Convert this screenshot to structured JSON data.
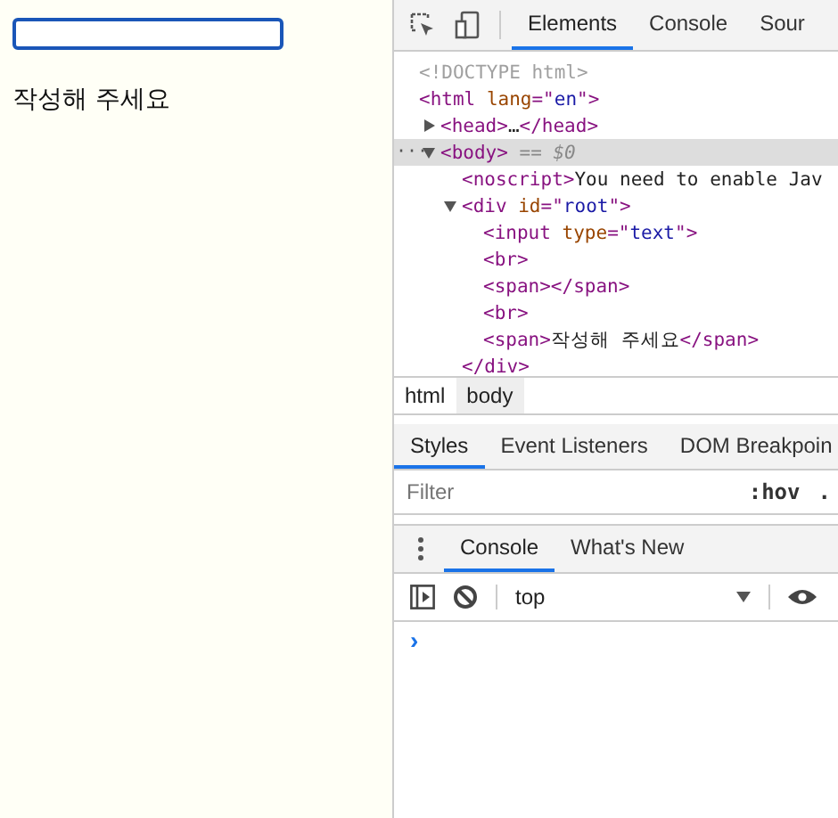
{
  "page": {
    "input": {
      "focused": true
    },
    "message": "작성해 주세요"
  },
  "devtools": {
    "main_tabs": [
      {
        "label": "Elements",
        "selected": true
      },
      {
        "label": "Console",
        "selected": false
      },
      {
        "label": "Sour",
        "selected": false
      }
    ],
    "dom_tree": [
      {
        "selected": false,
        "tokens": [
          {
            "kind": "doctype",
            "text": "<!DOCTYPE html>"
          }
        ]
      },
      {
        "selected": false,
        "tokens": [
          {
            "kind": "tag",
            "text": "<html "
          },
          {
            "kind": "attr",
            "text": "lang"
          },
          {
            "kind": "tag",
            "text": "=\""
          },
          {
            "kind": "value",
            "text": "en"
          },
          {
            "kind": "tag",
            "text": "\">"
          }
        ],
        "children": [
          {
            "selected": false,
            "expanded": false,
            "tokens": [
              {
                "kind": "tag",
                "text": "<head>"
              },
              {
                "kind": "text",
                "text": "…"
              },
              {
                "kind": "tag",
                "text": "</head>"
              }
            ]
          },
          {
            "selected": true,
            "expanded": true,
            "tokens": [
              {
                "kind": "tag",
                "text": "<body>"
              },
              {
                "kind": "dim",
                "text": " == $0"
              }
            ],
            "children": [
              {
                "selected": false,
                "tokens": [
                  {
                    "kind": "tag",
                    "text": "<noscript>"
                  },
                  {
                    "kind": "text",
                    "text": "You need to enable Jav"
                  }
                ]
              },
              {
                "selected": false,
                "expanded": true,
                "tokens": [
                  {
                    "kind": "tag",
                    "text": "<div "
                  },
                  {
                    "kind": "attr",
                    "text": "id"
                  },
                  {
                    "kind": "tag",
                    "text": "=\""
                  },
                  {
                    "kind": "value",
                    "text": "root"
                  },
                  {
                    "kind": "tag",
                    "text": "\">"
                  }
                ],
                "children": [
                  {
                    "selected": false,
                    "tokens": [
                      {
                        "kind": "tag",
                        "text": "<input "
                      },
                      {
                        "kind": "attr",
                        "text": "type"
                      },
                      {
                        "kind": "tag",
                        "text": "=\""
                      },
                      {
                        "kind": "value",
                        "text": "text"
                      },
                      {
                        "kind": "tag",
                        "text": "\">"
                      }
                    ]
                  },
                  {
                    "selected": false,
                    "tokens": [
                      {
                        "kind": "tag",
                        "text": "<br>"
                      }
                    ]
                  },
                  {
                    "selected": false,
                    "tokens": [
                      {
                        "kind": "tag",
                        "text": "<span></span>"
                      }
                    ]
                  },
                  {
                    "selected": false,
                    "tokens": [
                      {
                        "kind": "tag",
                        "text": "<br>"
                      }
                    ]
                  },
                  {
                    "selected": false,
                    "tokens": [
                      {
                        "kind": "tag",
                        "text": "<span>"
                      },
                      {
                        "kind": "text",
                        "text": "작성해 주세요"
                      },
                      {
                        "kind": "tag",
                        "text": "</span>"
                      }
                    ]
                  }
                ],
                "closing": [
                  {
                    "kind": "tag",
                    "text": "</div>"
                  }
                ]
              }
            ]
          }
        ]
      }
    ],
    "breadcrumbs": [
      {
        "label": "html",
        "selected": false
      },
      {
        "label": "body",
        "selected": true
      }
    ],
    "style_tabs": [
      {
        "label": "Styles",
        "selected": true
      },
      {
        "label": "Event Listeners",
        "selected": false
      },
      {
        "label": "DOM Breakpoin",
        "selected": false
      }
    ],
    "filter": {
      "placeholder": "Filter",
      "hov": ":hov",
      "more": "."
    },
    "drawer_tabs": [
      {
        "label": "Console",
        "selected": true
      },
      {
        "label": "What's New",
        "selected": false
      }
    ],
    "console_context": "top",
    "prompt": "›",
    "selected_marker": "···"
  }
}
